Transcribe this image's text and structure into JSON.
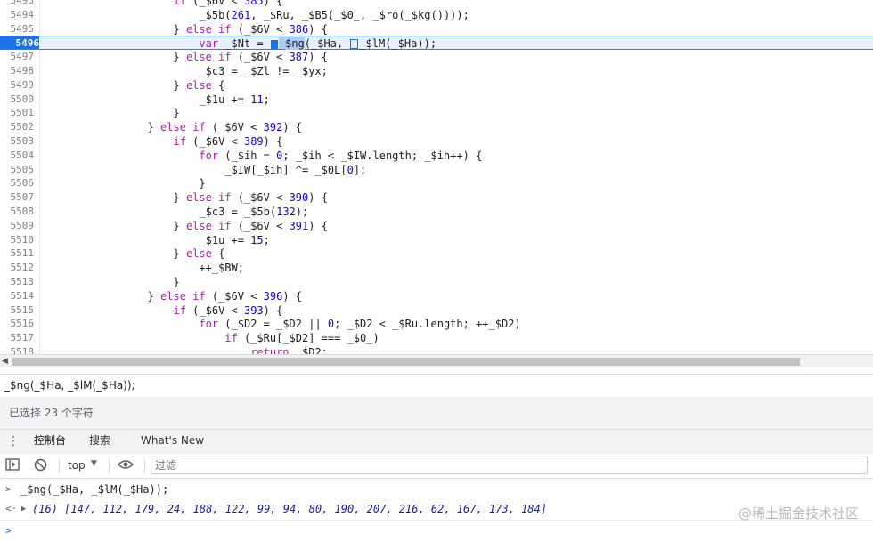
{
  "editor": {
    "lines": [
      {
        "no": "5493",
        "indent": "            ",
        "parts": [
          [
            "kw",
            "if"
          ],
          [
            "t",
            " (_$6V < "
          ],
          [
            "num",
            "385"
          ],
          [
            "t",
            ") {"
          ]
        ]
      },
      {
        "no": "5494",
        "indent": "                ",
        "parts": [
          [
            "t",
            "_$5b("
          ],
          [
            "num",
            "261"
          ],
          [
            "t",
            ", _$Ru, _$B5(_$0_, _$ro(_$kg())));"
          ]
        ]
      },
      {
        "no": "5495",
        "indent": "            ",
        "parts": [
          [
            "t",
            "} "
          ],
          [
            "kw",
            "else if"
          ],
          [
            "t",
            " (_$6V < "
          ],
          [
            "num",
            "386"
          ],
          [
            "t",
            ") {"
          ]
        ]
      },
      {
        "no": "5496",
        "indent": "                ",
        "parts": [
          [
            "kw",
            "var"
          ],
          [
            "t",
            " _$Nt = "
          ],
          [
            "m",
            ""
          ],
          [
            "s",
            "_$ng"
          ],
          [
            "t",
            "(_$Ha, "
          ],
          [
            "mo",
            ""
          ],
          [
            "t",
            "_$lM(_$Ha));"
          ]
        ],
        "current": true
      },
      {
        "no": "5497",
        "indent": "            ",
        "parts": [
          [
            "t",
            "} "
          ],
          [
            "kw",
            "else if"
          ],
          [
            "t",
            " (_$6V < "
          ],
          [
            "num",
            "387"
          ],
          [
            "t",
            ") {"
          ]
        ]
      },
      {
        "no": "5498",
        "indent": "                ",
        "parts": [
          [
            "t",
            "_$c3 = _$Zl != _$yx;"
          ]
        ]
      },
      {
        "no": "5499",
        "indent": "            ",
        "parts": [
          [
            "t",
            "} "
          ],
          [
            "kw",
            "else"
          ],
          [
            "t",
            " {"
          ]
        ]
      },
      {
        "no": "5500",
        "indent": "                ",
        "parts": [
          [
            "t",
            "_$1u += "
          ],
          [
            "num",
            "11"
          ],
          [
            "t",
            ";"
          ]
        ]
      },
      {
        "no": "5501",
        "indent": "            ",
        "parts": [
          [
            "t",
            "}"
          ]
        ]
      },
      {
        "no": "5502",
        "indent": "        ",
        "parts": [
          [
            "t",
            "} "
          ],
          [
            "kw",
            "else if"
          ],
          [
            "t",
            " (_$6V < "
          ],
          [
            "num",
            "392"
          ],
          [
            "t",
            ") {"
          ]
        ]
      },
      {
        "no": "5503",
        "indent": "            ",
        "parts": [
          [
            "kw",
            "if"
          ],
          [
            "t",
            " (_$6V < "
          ],
          [
            "num",
            "389"
          ],
          [
            "t",
            ") {"
          ]
        ]
      },
      {
        "no": "5504",
        "indent": "                ",
        "parts": [
          [
            "kw",
            "for"
          ],
          [
            "t",
            " (_$ih = "
          ],
          [
            "num",
            "0"
          ],
          [
            "t",
            "; _$ih < _$IW.length; _$ih++) {"
          ]
        ]
      },
      {
        "no": "5505",
        "indent": "                    ",
        "parts": [
          [
            "t",
            "_$IW[_$ih] ^= _$0L["
          ],
          [
            "num",
            "0"
          ],
          [
            "t",
            "];"
          ]
        ]
      },
      {
        "no": "5506",
        "indent": "                ",
        "parts": [
          [
            "t",
            "}"
          ]
        ]
      },
      {
        "no": "5507",
        "indent": "            ",
        "parts": [
          [
            "t",
            "} "
          ],
          [
            "kw",
            "else if"
          ],
          [
            "t",
            " (_$6V < "
          ],
          [
            "num",
            "390"
          ],
          [
            "t",
            ") {"
          ]
        ]
      },
      {
        "no": "5508",
        "indent": "                ",
        "parts": [
          [
            "t",
            "_$c3 = _$5b("
          ],
          [
            "num",
            "132"
          ],
          [
            "t",
            ");"
          ]
        ]
      },
      {
        "no": "5509",
        "indent": "            ",
        "parts": [
          [
            "t",
            "} "
          ],
          [
            "kw",
            "else if"
          ],
          [
            "t",
            " (_$6V < "
          ],
          [
            "num",
            "391"
          ],
          [
            "t",
            ") {"
          ]
        ]
      },
      {
        "no": "5510",
        "indent": "                ",
        "parts": [
          [
            "t",
            "_$1u += "
          ],
          [
            "num",
            "15"
          ],
          [
            "t",
            ";"
          ]
        ]
      },
      {
        "no": "5511",
        "indent": "            ",
        "parts": [
          [
            "t",
            "} "
          ],
          [
            "kw",
            "else"
          ],
          [
            "t",
            " {"
          ]
        ]
      },
      {
        "no": "5512",
        "indent": "                ",
        "parts": [
          [
            "t",
            "++_$BW;"
          ]
        ]
      },
      {
        "no": "5513",
        "indent": "            ",
        "parts": [
          [
            "t",
            "}"
          ]
        ]
      },
      {
        "no": "5514",
        "indent": "        ",
        "parts": [
          [
            "t",
            "} "
          ],
          [
            "kw",
            "else if"
          ],
          [
            "t",
            " (_$6V < "
          ],
          [
            "num",
            "396"
          ],
          [
            "t",
            ") {"
          ]
        ]
      },
      {
        "no": "5515",
        "indent": "            ",
        "parts": [
          [
            "kw",
            "if"
          ],
          [
            "t",
            " (_$6V < "
          ],
          [
            "num",
            "393"
          ],
          [
            "t",
            ") {"
          ]
        ]
      },
      {
        "no": "5516",
        "indent": "                ",
        "parts": [
          [
            "kw",
            "for"
          ],
          [
            "t",
            " (_$D2 = _$D2 || "
          ],
          [
            "num",
            "0"
          ],
          [
            "t",
            "; _$D2 < _$Ru.length; ++_$D2)"
          ]
        ]
      },
      {
        "no": "5517",
        "indent": "                    ",
        "parts": [
          [
            "kw",
            "if"
          ],
          [
            "t",
            " (_$Ru[_$D2] === _$0_)"
          ]
        ]
      },
      {
        "no": "5518",
        "indent": "                        ",
        "parts": [
          [
            "kw",
            "return"
          ],
          [
            "t",
            " _$D2;"
          ]
        ]
      }
    ]
  },
  "expression_bar": {
    "text": "_$ng(_$Ha, _$lM(_$Ha));"
  },
  "status": {
    "text": "已选择 23 个字符"
  },
  "drawer": {
    "tabs": [
      {
        "label": "控制台"
      },
      {
        "label": "搜索"
      },
      {
        "label": "What's New"
      }
    ]
  },
  "console_toolbar": {
    "context": "top",
    "filter_placeholder": "过滤"
  },
  "console": {
    "input": "_$ng(_$Ha, _$lM(_$Ha));",
    "result": "(16) [147, 112, 179, 24, 188, 122, 99, 94, 80, 190, 207, 216, 62, 167, 173, 184]"
  },
  "watermark": "@稀土掘金技术社区",
  "icons": {
    "kebab": "more-vertical-icon",
    "sidebar_toggle": "sidebar-toggle-icon",
    "clear": "clear-console-icon",
    "eye": "live-expression-icon"
  }
}
